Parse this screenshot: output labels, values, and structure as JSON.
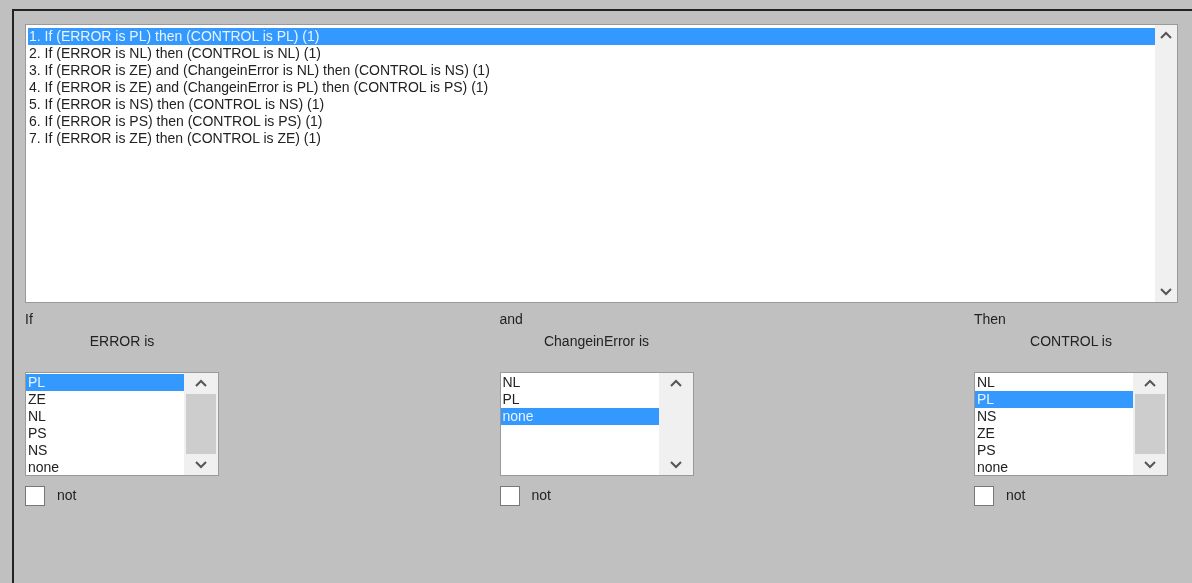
{
  "rules": [
    {
      "text": "1. If (ERROR is PL) then (CONTROL is PL) (1)",
      "selected": true
    },
    {
      "text": "2. If (ERROR is NL) then (CONTROL is NL) (1)",
      "selected": false
    },
    {
      "text": "3. If (ERROR is ZE) and (ChangeinError is NL) then (CONTROL is NS) (1)",
      "selected": false
    },
    {
      "text": "4. If (ERROR is ZE) and (ChangeinError is PL) then (CONTROL is PS) (1)",
      "selected": false
    },
    {
      "text": "5. If (ERROR is NS) then (CONTROL is NS) (1)",
      "selected": false
    },
    {
      "text": "6. If (ERROR is PS) then (CONTROL is PS) (1)",
      "selected": false
    },
    {
      "text": "7. If (ERROR is ZE) then (CONTROL is ZE) (1)",
      "selected": false
    }
  ],
  "columns": [
    {
      "heading": "If",
      "label": "ERROR is",
      "options": [
        {
          "text": "PL",
          "selected": true
        },
        {
          "text": "ZE",
          "selected": false
        },
        {
          "text": "NL",
          "selected": false
        },
        {
          "text": "PS",
          "selected": false
        },
        {
          "text": "NS",
          "selected": false
        },
        {
          "text": "none",
          "selected": false
        }
      ],
      "not_label": "not",
      "not_checked": false
    },
    {
      "heading": "and",
      "label": "ChangeinError is",
      "options": [
        {
          "text": "NL",
          "selected": false
        },
        {
          "text": "PL",
          "selected": false
        },
        {
          "text": "none",
          "selected": true
        }
      ],
      "not_label": "not",
      "not_checked": false
    },
    {
      "heading": "Then",
      "label": "CONTROL is",
      "options": [
        {
          "text": "NL",
          "selected": false
        },
        {
          "text": "PL",
          "selected": true
        },
        {
          "text": "NS",
          "selected": false
        },
        {
          "text": "ZE",
          "selected": false
        },
        {
          "text": "PS",
          "selected": false
        },
        {
          "text": "none",
          "selected": false
        }
      ],
      "not_label": "not",
      "not_checked": false
    }
  ]
}
